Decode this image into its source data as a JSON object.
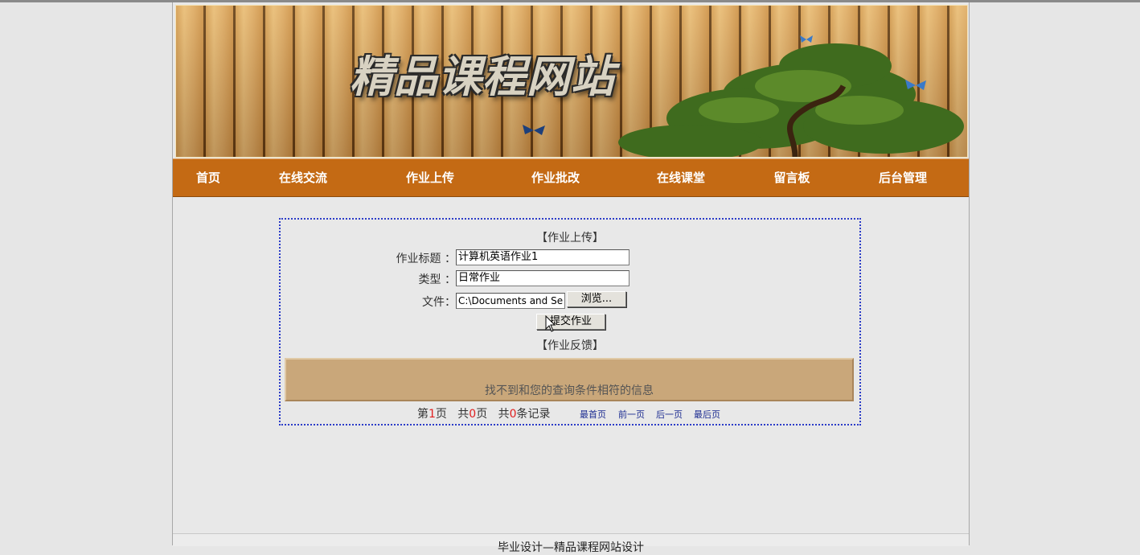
{
  "site": {
    "logo_text": "精品课程网站"
  },
  "nav": {
    "items": [
      "首页",
      "在线交流",
      "作业上传",
      "作业批改",
      "在线课堂",
      "留言板",
      "后台管理"
    ]
  },
  "upload_form": {
    "section_title": "【作业上传】",
    "title_label": "作业标题 ：",
    "title_value": "计算机英语作业1",
    "type_label": "类型 ：",
    "type_value": "日常作业",
    "file_label": "文件：",
    "file_value": "C:\\Documents and Se",
    "browse_label": "浏览...",
    "submit_label": "提交作业"
  },
  "feedback": {
    "section_title": "【作业反馈】",
    "empty_message": "找不到和您的查询条件相符的信息"
  },
  "pager": {
    "page_prefix": "第",
    "page_current": "1",
    "page_suffix": "页",
    "total_prefix": "共",
    "total_pages": "0",
    "total_suffix": "页",
    "records_prefix": "共",
    "records_count": "0",
    "records_suffix": "条记录",
    "first": "最首页",
    "prev": "前一页",
    "next": "后一页",
    "last": "最后页"
  },
  "footer": {
    "text": "毕业设计—精品课程网站设计"
  },
  "colors": {
    "nav_bg": "#c46a14",
    "box_border": "#2b3cc8",
    "feedback_bg": "#c9a77a",
    "pager_number": "#e02020",
    "pager_link": "#1a2a90"
  }
}
